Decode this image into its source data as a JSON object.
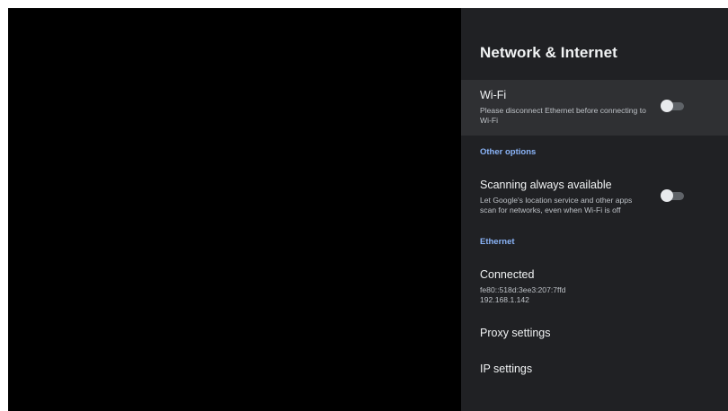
{
  "panel": {
    "title": "Network & Internet",
    "wifi": {
      "title": "Wi-Fi",
      "subtitle_line1": "Please disconnect Ethernet before connecting to",
      "subtitle_line2": "Wi-Fi",
      "toggle_on": false
    },
    "other_options_header": "Other options",
    "scanning": {
      "title": "Scanning always available",
      "subtitle_line1": "Let Google's location service and other apps",
      "subtitle_line2": "scan for networks, even when Wi-Fi is off",
      "toggle_on": false
    },
    "ethernet_header": "Ethernet",
    "connected": {
      "title": "Connected",
      "ipv6": "fe80::518d:3ee3:207:7ffd",
      "ipv4": "192.168.1.142"
    },
    "proxy_label": "Proxy settings",
    "ip_label": "IP settings"
  },
  "colors": {
    "panel_bg": "#202124",
    "focused_row_bg": "#2f3033",
    "accent": "#8ab4f8",
    "video_bg": "#000000"
  }
}
